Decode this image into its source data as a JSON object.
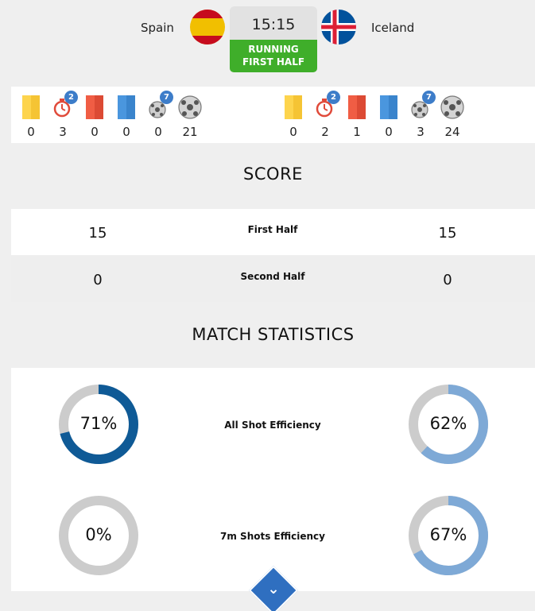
{
  "header": {
    "home_team": "Spain",
    "away_team": "Iceland",
    "clock": "15:15",
    "status_line1": "RUNNING",
    "status_line2": "FIRST HALF",
    "status_color": "#3fae2a"
  },
  "stats_strip": {
    "home": [
      {
        "icon": "yellow-card-icon",
        "value": "0"
      },
      {
        "icon": "timer-icon",
        "value": "3",
        "badge": "2"
      },
      {
        "icon": "red-card-icon",
        "value": "0"
      },
      {
        "icon": "blue-card-icon",
        "value": "0"
      },
      {
        "icon": "small-ball-icon",
        "value": "0",
        "badge": "7"
      },
      {
        "icon": "ball-icon",
        "value": "21"
      }
    ],
    "away": [
      {
        "icon": "yellow-card-icon",
        "value": "0"
      },
      {
        "icon": "timer-icon",
        "value": "2",
        "badge": "2"
      },
      {
        "icon": "red-card-icon",
        "value": "1"
      },
      {
        "icon": "blue-card-icon",
        "value": "0"
      },
      {
        "icon": "small-ball-icon",
        "value": "3",
        "badge": "7"
      },
      {
        "icon": "ball-icon",
        "value": "24"
      }
    ]
  },
  "score": {
    "title": "SCORE",
    "rows": [
      {
        "label": "First Half",
        "home": "15",
        "away": "15"
      },
      {
        "label": "Second Half",
        "home": "0",
        "away": "0"
      }
    ]
  },
  "match_stats": {
    "title": "MATCH STATISTICS",
    "rows": [
      {
        "label": "All Shot Efficiency",
        "home": "71%",
        "away": "62%",
        "home_fraction": 0.71,
        "away_fraction": 0.62
      },
      {
        "label": "7m Shots Efficiency",
        "home": "0%",
        "away": "67%",
        "home_fraction": 0.0,
        "away_fraction": 0.67
      }
    ],
    "home_color": "#0f5a96",
    "away_color": "#7ea9d6",
    "track_color": "#cccccc"
  }
}
